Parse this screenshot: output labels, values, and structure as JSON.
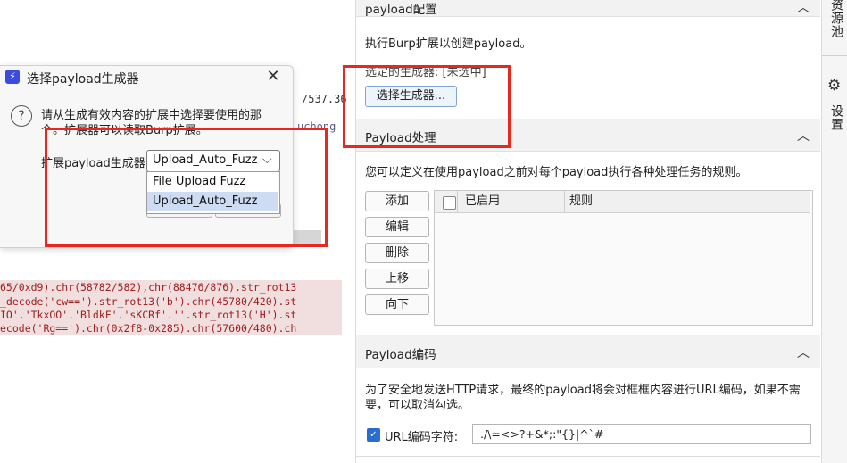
{
  "bg_fragments": {
    "right_code_1": "/537.36",
    "right_code_2": "uchong",
    "code_lines": [
      "65/0xd9).chr(58782/582),chr(88476/876).str_rot13",
      "_decode('cw==').str_rot13('b').chr(45780/420).st",
      "IO'.'TkxOO'.'BldkF'.'sKCRf'.''.str_rot13('H').st",
      "ecode('Rg==').chr(0x2f8-0x285).chr(57600/480).ch"
    ]
  },
  "dialog": {
    "title": "选择payload生成器",
    "message_line1": "请从生成有效内容的扩展中选择要使用的那",
    "message_line2": "个。扩展器可以读取Burp扩展。",
    "ext_label": "扩展payload生成器",
    "selected": "Upload_Auto_Fuzz",
    "options": [
      "File Upload Fuzz",
      "Upload_Auto_Fuzz"
    ]
  },
  "payload_config": {
    "title": "payload配置",
    "desc": "执行Burp扩展以创建payload。",
    "selected_gen": "选定的生成器: [未选中]",
    "select_button": "选择生成器..."
  },
  "payload_processing": {
    "title": "Payload处理",
    "desc": "您可以定义在使用payload之前对每个payload执行各种处理任务的规则。",
    "buttons": [
      "添加",
      "编辑",
      "删除",
      "上移",
      "向下"
    ],
    "columns": [
      "已启用",
      "规则"
    ]
  },
  "payload_encoding": {
    "title": "Payload编码",
    "desc_line1": "为了安全地发送HTTP请求，最终的payload将会对框框内容进行URL编码，如果不需",
    "desc_line2": "要，可以取消勾选。",
    "checkbox_label": "URL编码字符:",
    "chars": "./\\=<>?+&*;:\"{}|^`#"
  },
  "sidebar": {
    "resources": "资源池",
    "settings": "设置"
  },
  "colors": {
    "annotation_red": "#e8281e",
    "accent_blue": "#2a6dd1"
  }
}
